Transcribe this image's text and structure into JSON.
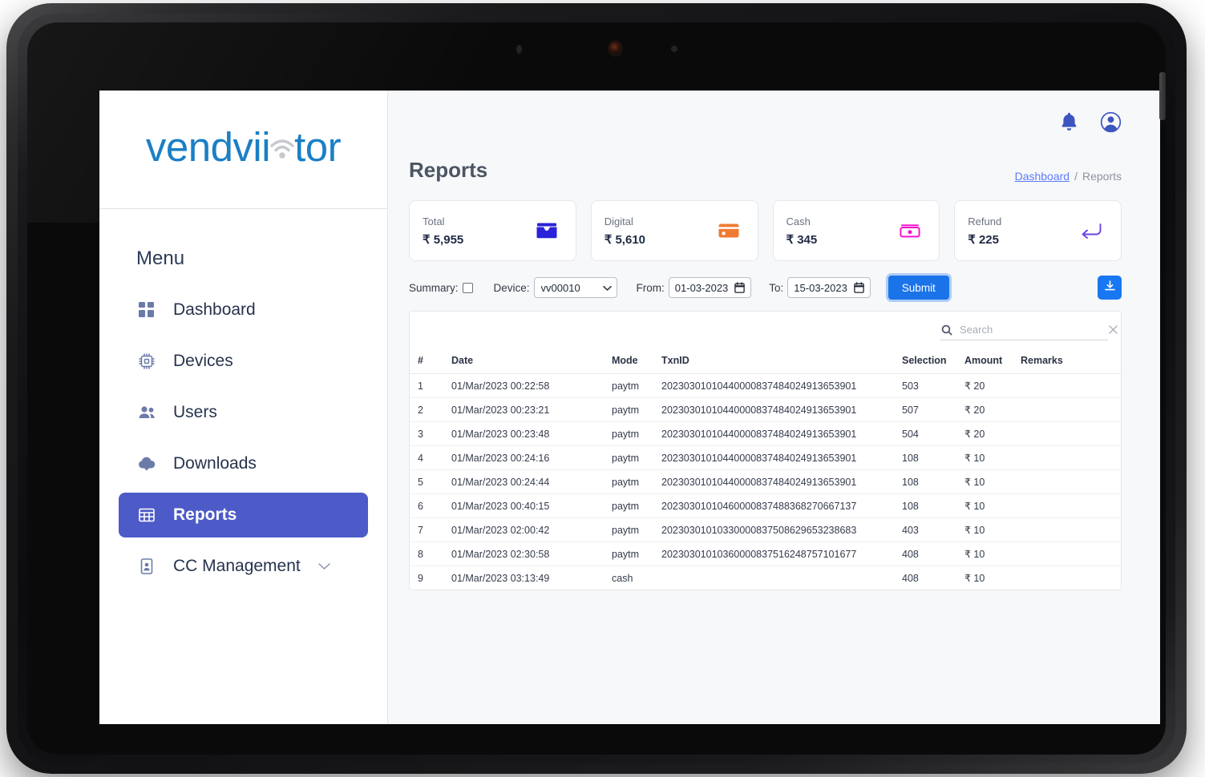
{
  "brand": {
    "text_before": "vendvii",
    "text_after": "tor",
    "wifi_icon": "wifi-icon",
    "color": "#1b7fc5"
  },
  "sidebar": {
    "menu_heading": "Menu",
    "items": [
      {
        "label": "Dashboard",
        "icon": "grid-icon",
        "active": false
      },
      {
        "label": "Devices",
        "icon": "chip-icon",
        "active": false
      },
      {
        "label": "Users",
        "icon": "users-icon",
        "active": false
      },
      {
        "label": "Downloads",
        "icon": "cloud-download-icon",
        "active": false
      },
      {
        "label": "Reports",
        "icon": "table-grid-icon",
        "active": true
      },
      {
        "label": "CC Management",
        "icon": "id-card-icon",
        "active": false,
        "chevron": "chevron-down-icon"
      }
    ],
    "active_color": "#4c5bc7"
  },
  "topbar": {
    "notification_icon": "bell-icon",
    "account_icon": "user-circle-icon",
    "icon_color": "#3c55bf"
  },
  "page": {
    "title": "Reports",
    "breadcrumb": {
      "link_label": "Dashboard",
      "separator": "/",
      "current": "Reports"
    }
  },
  "stats": [
    {
      "label": "Total",
      "value": "₹ 5,955",
      "icon": "wallet-icon",
      "color": "#2a22d8"
    },
    {
      "label": "Digital",
      "value": "₹ 5,610",
      "icon": "credit-card-icon",
      "color": "#ef7b32"
    },
    {
      "label": "Cash",
      "value": "₹ 345",
      "icon": "banknote-icon",
      "color": "#f215d0"
    },
    {
      "label": "Refund",
      "value": "₹ 225",
      "icon": "return-arrow-icon",
      "color": "#6e46e0"
    }
  ],
  "filters": {
    "summary_label": "Summary:",
    "summary_checked": false,
    "device_label": "Device:",
    "device_value": "vv00010",
    "device_options": [
      "vv00010"
    ],
    "from_label": "From:",
    "from_value": "01-03-2023",
    "to_label": "To:",
    "to_value": "15-03-2023",
    "submit_label": "Submit",
    "calendar_icon": "calendar-icon",
    "download_icon": "download-icon"
  },
  "search": {
    "placeholder": "Search",
    "value": "",
    "search_icon": "search-icon",
    "clear_icon": "close-icon"
  },
  "table": {
    "headers": [
      "#",
      "Date",
      "Mode",
      "TxnID",
      "Selection",
      "Amount",
      "Remarks"
    ],
    "rows": [
      {
        "idx": "1",
        "date": "01/Mar/2023 00:22:58",
        "mode": "paytm",
        "txnid": "20230301010440000837484024913653901",
        "selection": "503",
        "amount": "₹ 20",
        "remarks": ""
      },
      {
        "idx": "2",
        "date": "01/Mar/2023 00:23:21",
        "mode": "paytm",
        "txnid": "20230301010440000837484024913653901",
        "selection": "507",
        "amount": "₹ 20",
        "remarks": ""
      },
      {
        "idx": "3",
        "date": "01/Mar/2023 00:23:48",
        "mode": "paytm",
        "txnid": "20230301010440000837484024913653901",
        "selection": "504",
        "amount": "₹ 20",
        "remarks": ""
      },
      {
        "idx": "4",
        "date": "01/Mar/2023 00:24:16",
        "mode": "paytm",
        "txnid": "20230301010440000837484024913653901",
        "selection": "108",
        "amount": "₹ 10",
        "remarks": ""
      },
      {
        "idx": "5",
        "date": "01/Mar/2023 00:24:44",
        "mode": "paytm",
        "txnid": "20230301010440000837484024913653901",
        "selection": "108",
        "amount": "₹ 10",
        "remarks": ""
      },
      {
        "idx": "6",
        "date": "01/Mar/2023 00:40:15",
        "mode": "paytm",
        "txnid": "20230301010460000837488368270667137",
        "selection": "108",
        "amount": "₹ 10",
        "remarks": ""
      },
      {
        "idx": "7",
        "date": "01/Mar/2023 02:00:42",
        "mode": "paytm",
        "txnid": "20230301010330000837508629653238683",
        "selection": "403",
        "amount": "₹ 10",
        "remarks": ""
      },
      {
        "idx": "8",
        "date": "01/Mar/2023 02:30:58",
        "mode": "paytm",
        "txnid": "20230301010360000837516248757101677",
        "selection": "408",
        "amount": "₹ 10",
        "remarks": ""
      },
      {
        "idx": "9",
        "date": "01/Mar/2023 03:13:49",
        "mode": "cash",
        "txnid": "",
        "selection": "408",
        "amount": "₹ 10",
        "remarks": ""
      }
    ]
  }
}
